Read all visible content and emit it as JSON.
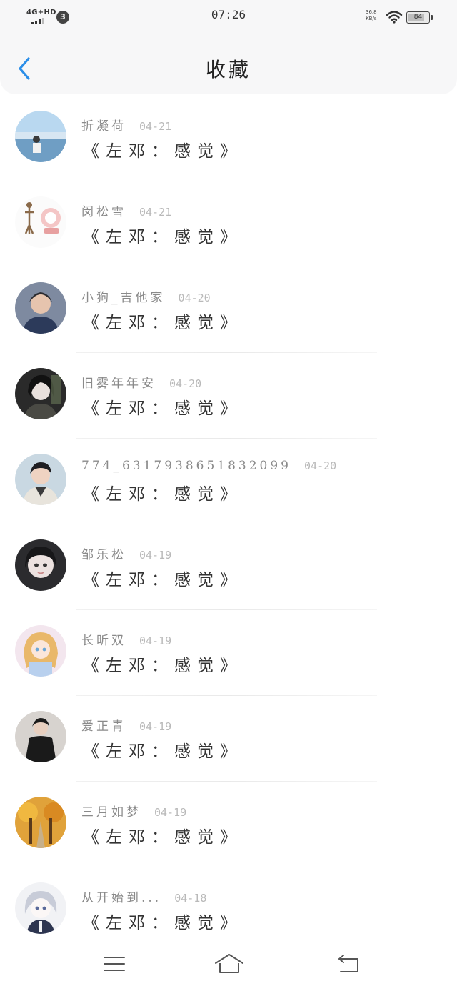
{
  "status_bar": {
    "network": "4G+HD",
    "notification_count": "3",
    "time": "07:26",
    "speed_value": "36.8",
    "speed_unit": "KB/s",
    "battery_level": "84"
  },
  "header": {
    "title": "收藏",
    "back_icon": "chevron-left-icon"
  },
  "favorites": [
    {
      "username": "折凝荷",
      "date": "04-21",
      "title": "《左邓：感觉》"
    },
    {
      "username": "闵松雪",
      "date": "04-21",
      "title": "《左邓：感觉》"
    },
    {
      "username": "小狗_吉他家",
      "date": "04-20",
      "title": "《左邓：感觉》"
    },
    {
      "username": "旧雾年年安",
      "date": "04-20",
      "title": "《左邓：感觉》"
    },
    {
      "username": "774_6317938651832099",
      "date": "04-20",
      "title": "《左邓：感觉》"
    },
    {
      "username": "邹乐松",
      "date": "04-19",
      "title": "《左邓：感觉》"
    },
    {
      "username": "长昕双",
      "date": "04-19",
      "title": "《左邓：感觉》"
    },
    {
      "username": "爱正青",
      "date": "04-19",
      "title": "《左邓：感觉》"
    },
    {
      "username": "三月如梦",
      "date": "04-19",
      "title": "《左邓：感觉》"
    },
    {
      "username": "从开始到...",
      "date": "04-18",
      "title": "《左邓：感觉》"
    }
  ],
  "bottom_nav": {
    "menu_icon": "menu-icon",
    "home_icon": "home-icon",
    "back_icon": "back-arrow-icon"
  },
  "colors": {
    "accent": "#2b8ee8",
    "background": "#ffffff",
    "header_bg": "#f7f7f8",
    "username": "#8a8a8a",
    "date": "#b9b9b9"
  }
}
